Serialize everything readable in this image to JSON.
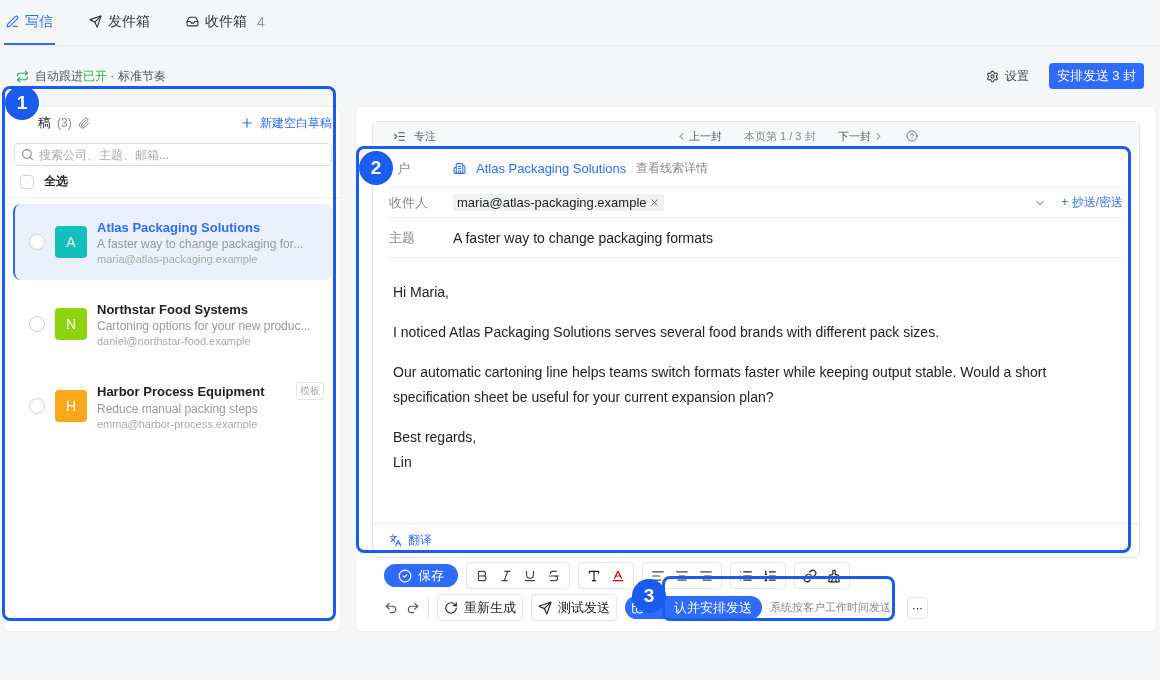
{
  "tabs": [
    {
      "kind": "compose",
      "label": "写信",
      "selected": true
    },
    {
      "kind": "outbox",
      "label": "发件箱",
      "selected": false
    },
    {
      "kind": "inbox",
      "label": "收件箱",
      "count": "4",
      "selected": false
    }
  ],
  "status": {
    "prefix": "自动跟进",
    "state": "已开",
    "suffix": " · 标准节奏"
  },
  "settings": "设置",
  "schedule_button": "安排发送 3 封",
  "drafts": {
    "title": "稿",
    "count": "(3)",
    "new_draft": "新建空白草稿",
    "search": {
      "placeholder": "搜索公司、主题、邮箱..."
    },
    "select_all": {
      "label": "全选",
      "checked": false
    },
    "items": [
      {
        "initial": "A",
        "color": "#14c0bd",
        "company": "Atlas Packaging Solutions",
        "subject": "A faster way to change packaging for...",
        "email": "maria@atlas-packaging.example",
        "selected": true,
        "checked": false
      },
      {
        "initial": "N",
        "color": "#8fd20f",
        "company": "Northstar Food Systems",
        "subject": "Cartoning options for your new produc...",
        "email": "daniel@northstar-food.example",
        "selected": false,
        "checked": false
      },
      {
        "initial": "H",
        "color": "#f7a81b",
        "company": "Harbor Process Equipment",
        "tag": "模板",
        "subject": "Reduce manual packing steps",
        "email": "emma@harbor-process.example",
        "selected": false,
        "checked": false
      }
    ]
  },
  "editor": {
    "focus": "专注",
    "prev": "上一封",
    "page": "本页第 1 / 3 封",
    "next": "下一封",
    "customer_label": "户",
    "customer": "Atlas Packaging Solutions",
    "lead_link": "查看线索详情",
    "recipient_label": "收件人",
    "recipient": "maria@atlas-packaging.example",
    "cc": "+ 抄送/密送",
    "subject_label": "主题",
    "subject": "A faster way to change packaging formats",
    "body": [
      [
        "Hi Maria,"
      ],
      [
        "I noticed Atlas Packaging Solutions serves several food brands with different pack sizes."
      ],
      [
        "Our automatic cartoning line helps teams switch formats faster while keeping output stable. Would a short",
        "specification sheet be useful for your current expansion plan?"
      ],
      [
        "Best regards,",
        "Lin"
      ]
    ],
    "translate": "翻译"
  },
  "toolbar": {
    "save": "保存",
    "regenerate": "重新生成",
    "test_send": "测试发送",
    "confirm": "认并安排发送",
    "hint": "系统按客户工作时间发送",
    "more": "···"
  },
  "annotations": [
    {
      "number": "1"
    },
    {
      "number": "2"
    },
    {
      "number": "3"
    }
  ]
}
